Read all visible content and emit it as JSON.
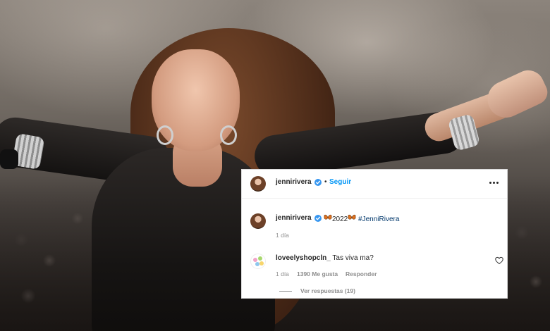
{
  "post": {
    "header_username": "jennirivera",
    "separator": "•",
    "follow_label": "Seguir",
    "caption_username": "jennirivera",
    "caption_year": "2022",
    "caption_hashtag": "#JenniRivera",
    "caption_time": "1 día"
  },
  "comment": {
    "username": "loveelyshopcln_",
    "text": "Tas viva ma?",
    "time": "1 día",
    "likes": "1390 Me gusta",
    "reply_label": "Responder",
    "view_replies": "Ver respuestas (19)"
  },
  "colors": {
    "follow_blue": "#0095f6",
    "verified_blue": "#3897f0",
    "hashtag_blue": "#00376b",
    "muted_gray": "#8e8e8e"
  },
  "icons": [
    "verified-badge-icon",
    "more-options-icon",
    "butterfly-icon",
    "heart-icon"
  ]
}
